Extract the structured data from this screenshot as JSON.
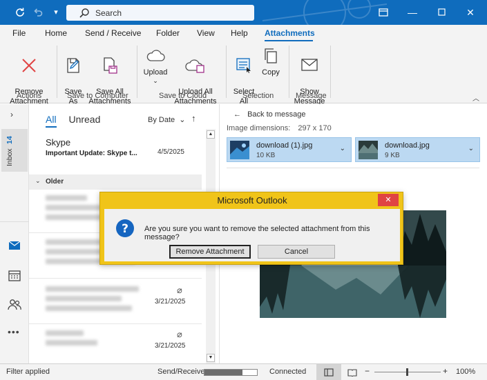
{
  "titlebar": {
    "search_placeholder": "Search"
  },
  "menu": {
    "items": [
      "File",
      "Home",
      "Send / Receive",
      "Folder",
      "View",
      "Help",
      "Attachments"
    ],
    "active": "Attachments"
  },
  "ribbon": {
    "buttons": {
      "remove_attachment": "Remove\nAttachment",
      "save_as": "Save\nAs",
      "save_all": "Save All\nAttachments",
      "upload": "Upload",
      "upload_all": "Upload All\nAttachments",
      "select_all": "Select\nAll",
      "copy": "Copy",
      "show_message": "Show\nMessage"
    },
    "groups": [
      "Actions",
      "Save to Computer",
      "Save to Cloud",
      "Selection",
      "Message"
    ]
  },
  "rail": {
    "inbox_label": "Inbox",
    "inbox_count": "14"
  },
  "message_list": {
    "tab_all": "All",
    "tab_unread": "Unread",
    "sort_label": "By Date",
    "top_item": {
      "sender": "Skype",
      "subject": "Important Update: Skype t...",
      "date": "4/5/2025"
    },
    "older_label": "Older",
    "dates": [
      "3/21/2025",
      "3/21/2025"
    ]
  },
  "reading_pane": {
    "back_label": "Back to message",
    "dims_label": "Image dimensions:",
    "dims_value": "297 x 170",
    "attachments": [
      {
        "name": "download (1).jpg",
        "size": "10 KB"
      },
      {
        "name": "download.jpg",
        "size": "9 KB"
      }
    ]
  },
  "dialog": {
    "title": "Microsoft Outlook",
    "message": "Are you sure you want to remove the selected attachment from this message?",
    "primary": "Remove Attachment",
    "secondary": "Cancel",
    "close": "✕"
  },
  "status": {
    "filter": "Filter applied",
    "send_receive": "Send/Receive",
    "send_receive_progress": 0.72,
    "connection": "Connected",
    "zoom": "100%"
  },
  "colors": {
    "brand": "#0f6cbd",
    "dialog_frame": "#f0c419",
    "close_red": "#e04343"
  }
}
